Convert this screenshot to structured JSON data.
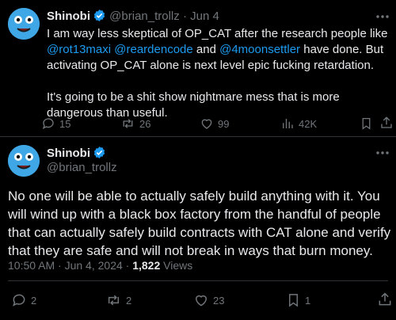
{
  "post1": {
    "display_name": "Shinobi",
    "handle": "@brian_trollz",
    "date": "Jun 4",
    "text_a": "I am way less skeptical of OP_CAT after the research people like ",
    "mention1": "@rot13maxi",
    "mention2": "@reardencode",
    "text_b": " and ",
    "mention3": "@4moonsettler",
    "text_c": " have done. But activating OP_CAT alone is next level epic fucking retardation.",
    "text_d": "It's going to be a shit show nightmare mess that is more dangerous than useful.",
    "replies": "15",
    "reposts": "26",
    "likes": "99",
    "views": "42K"
  },
  "post2": {
    "display_name": "Shinobi",
    "handle": "@brian_trollz",
    "text": "No one will be able to actually safely build anything with it. You will wind up with a black box factory from the handful of people that can actually safely build contracts with CAT alone and verify that they are safe and will not break in ways that burn money.",
    "timestamp": "10:50 AM · Jun 4, 2024 · ",
    "views_count": "1,822",
    "views_label": " Views",
    "replies": "2",
    "reposts": "2",
    "likes": "23",
    "bookmarks": "1"
  },
  "icons": {
    "verified": "verified-badge-icon",
    "more": "more-dots-icon",
    "reply": "reply-icon",
    "repost": "repost-icon",
    "like": "heart-icon",
    "views": "views-chart-icon",
    "bookmark": "bookmark-icon",
    "share": "share-icon"
  },
  "colors": {
    "background": "#000000",
    "text": "#e7e9ea",
    "muted": "#71767b",
    "link": "#1d9bf0",
    "verified": "#1d9bf0"
  }
}
